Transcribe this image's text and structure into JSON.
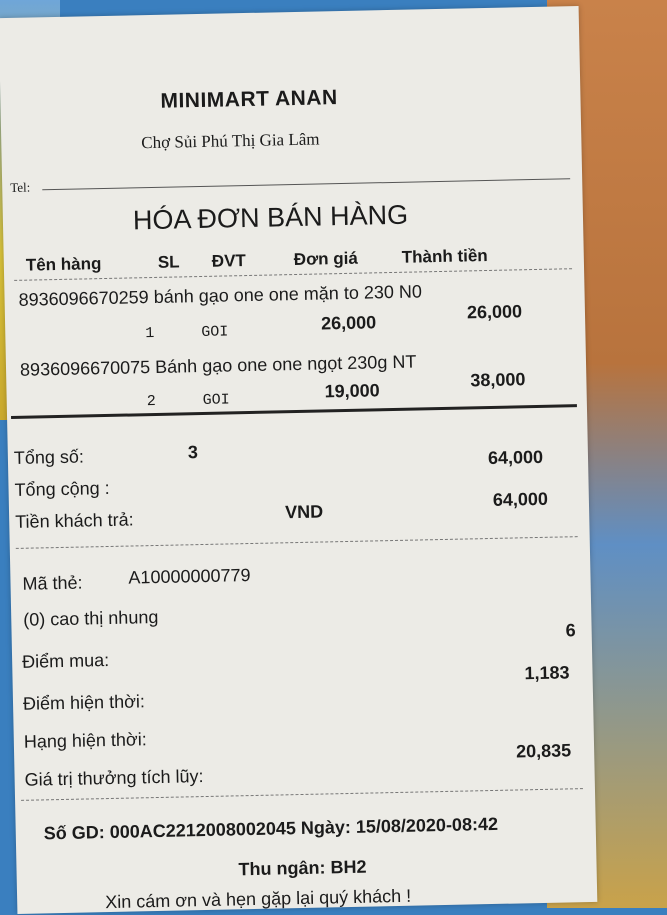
{
  "store": {
    "name": "MINIMART ANAN",
    "address": "Chợ Sủi Phú Thị Gia Lâm",
    "tel_label": "Tel:"
  },
  "title": "HÓA ĐƠN BÁN HÀNG",
  "columns": [
    "Tên hàng",
    "SL",
    "ĐVT",
    "Đơn giá",
    "Thành tiền"
  ],
  "items": [
    {
      "name": "8936096670259 bánh gạo one one mặn to 230 N0",
      "qty": "1",
      "unit": "GOI",
      "price": "26,000",
      "total": "26,000"
    },
    {
      "name": "8936096670075 Bánh gạo one one ngọt 230g NT",
      "qty": "2",
      "unit": "GOI",
      "price": "19,000",
      "total": "38,000"
    }
  ],
  "summary": {
    "total_qty_label": "Tổng số:",
    "total_qty": "3",
    "grand_total_label": "Tổng cộng :",
    "grand_total": "64,000",
    "paid_label": "Tiền khách trả:",
    "paid_currency": "VND",
    "paid": "64,000"
  },
  "member": {
    "card_label": "Mã thẻ:",
    "card_no": "A10000000779",
    "name": "(0) cao thị nhung",
    "points_buy_label": "Điểm mua:",
    "points_buy": "6",
    "points_current_label": "Điểm hiện thời:",
    "points_current": "1,183",
    "rank_label": "Hạng hiện thời:",
    "reward_label": "Giá trị thưởng tích lũy:",
    "reward": "20,835"
  },
  "footer": {
    "transaction": "Số GD: 000AC2212008002045 Ngày: 15/08/2020-08:42",
    "cashier": "Thu ngân: BH2",
    "thanks": "Xin cám ơn và hẹn gặp lại quý khách !"
  }
}
